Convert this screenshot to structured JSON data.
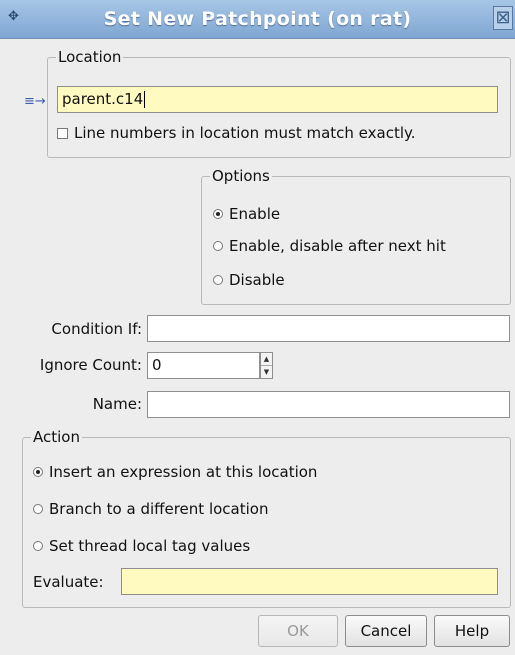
{
  "window": {
    "title": "Set New Patchpoint (on rat)",
    "close_glyph": "⊠"
  },
  "location": {
    "legend": "Location",
    "value": "parent.c14",
    "exact_match_label": "Line numbers in location must match exactly."
  },
  "options": {
    "legend": "Options",
    "items": [
      {
        "label": "Enable",
        "selected": true
      },
      {
        "label": "Enable, disable after next hit",
        "selected": false
      },
      {
        "label": "Disable",
        "selected": false
      }
    ]
  },
  "condition": {
    "label": "Condition If:",
    "value": ""
  },
  "ignore_count": {
    "label": "Ignore Count:",
    "value": "0"
  },
  "name": {
    "label": "Name:",
    "value": ""
  },
  "action": {
    "legend": "Action",
    "items": [
      {
        "label": "Insert an expression at this location",
        "selected": true
      },
      {
        "label": "Branch to a different location",
        "selected": false
      },
      {
        "label": "Set thread local tag values",
        "selected": false
      }
    ],
    "evaluate_label": "Evaluate:",
    "evaluate_value": ""
  },
  "buttons": {
    "ok": "OK",
    "cancel": "Cancel",
    "help": "Help"
  },
  "colors": {
    "titlebar": "#8fb3dc",
    "field_highlight": "#fffac0"
  },
  "icons": {
    "app": "patchpoint-icon",
    "location_marker": "arrow-right-icon",
    "close": "close-icon"
  }
}
